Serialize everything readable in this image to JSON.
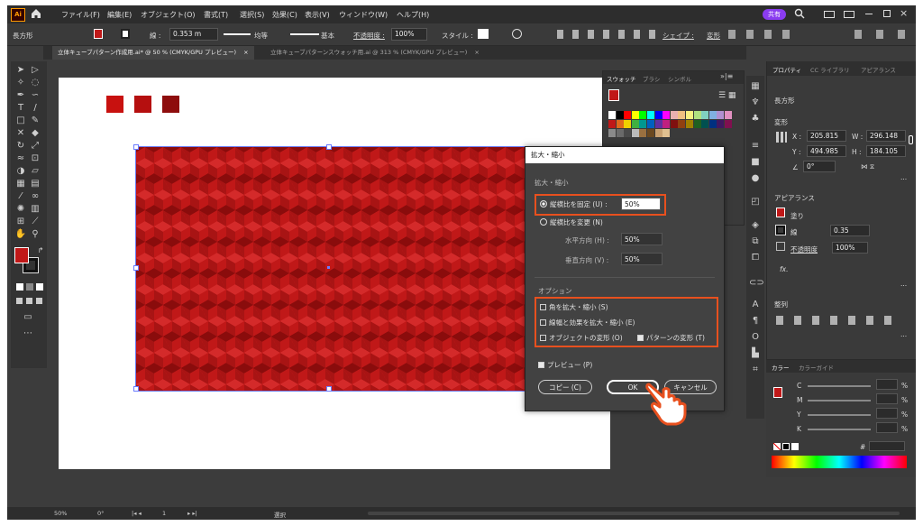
{
  "menubar": {
    "app_badge": "Ai",
    "items": [
      "ファイル(F)",
      "編集(E)",
      "オブジェクト(O)",
      "書式(T)",
      "選択(S)",
      "効果(C)",
      "表示(V)",
      "ウィンドウ(W)",
      "ヘルプ(H)"
    ],
    "share": "共有"
  },
  "control": {
    "object_type": "長方形",
    "stroke_label": "線 :",
    "stroke_value": "0.353 m",
    "stroke_profile": "均等",
    "brush": "基本",
    "opacity_label": "不透明度 :",
    "opacity_value": "100%",
    "style_label": "スタイル :",
    "shape_label": "シェイプ :",
    "transform_label": "変形"
  },
  "tabs": [
    {
      "label": "立体キューブパターン作成用.ai* @ 50 % (CMYK/GPU プレビュー)",
      "close": "×"
    },
    {
      "label": "立体キューブパターンスウォッチ用.ai @ 313 % (CMYK/GPU プレビュー)",
      "close": "×"
    }
  ],
  "swatches": {
    "tabs": [
      "スウォッチ",
      "ブラシ",
      "シンボル"
    ],
    "colors": [
      "#ffffff",
      "#000000",
      "#ff0000",
      "#ffff00",
      "#00ff00",
      "#00ffff",
      "#0000ff",
      "#ff00ff",
      "#e8b0b0",
      "#f0c080",
      "#f8f080",
      "#b0e080",
      "#80d0c0",
      "#80b0e0",
      "#b090d0",
      "#e090c0",
      "#c01818",
      "#e0681c",
      "#f0d000",
      "#40b040",
      "#009890",
      "#0060c0",
      "#6030a0",
      "#c02080",
      "#801010",
      "#904010",
      "#a08000",
      "#206020",
      "#005050",
      "#003080",
      "#401860",
      "#801050",
      "#8a8a8a",
      "#6a6a6a",
      "#4a4a4a",
      "#bbbbbb",
      "#9a7040",
      "#6a4820",
      "#c8a070",
      "#e0c090"
    ]
  },
  "dialog": {
    "title": "拡大・縮小",
    "section_scale": "拡大・縮小",
    "uniform_label": "縦横比を固定 (U) :",
    "uniform_value": "50%",
    "nonuniform_label": "縦横比を変更 (N)",
    "horizontal_label": "水平方向 (H) :",
    "horizontal_value": "50%",
    "vertical_label": "垂直方向 (V) :",
    "vertical_value": "50%",
    "section_options": "オプション",
    "opt_corners": "角を拡大・縮小 (S)",
    "opt_strokes": "線幅と効果を拡大・縮小 (E)",
    "opt_objects": "オブジェクトの変形 (O)",
    "opt_patterns": "パターンの変形 (T)",
    "preview": "プレビュー (P)",
    "copy_btn": "コピー (C)",
    "ok_btn": "OK",
    "cancel_btn": "キャンセル"
  },
  "properties": {
    "tabs": [
      "プロパティ",
      "CC ライブラリ",
      "アピアランス"
    ],
    "object_type": "長方形",
    "transform_title": "変形",
    "x_label": "X :",
    "x_value": "205.815",
    "w_label": "W :",
    "w_value": "296.148",
    "y_label": "Y :",
    "y_value": "494.985",
    "h_label": "H :",
    "h_value": "184.105",
    "angle_value": "0°",
    "appearance_title": "アピアランス",
    "fill_label": "塗り",
    "stroke_label": "線",
    "stroke_value": "0.35",
    "opacity_label": "不透明度",
    "opacity_value": "100%",
    "fx_label": "fx.",
    "align_title": "整列",
    "more": "..."
  },
  "color_panel": {
    "tabs": [
      "カラー",
      "カラーガイド"
    ],
    "channels": [
      {
        "label": "C",
        "unit": "%"
      },
      {
        "label": "M",
        "unit": "%"
      },
      {
        "label": "Y",
        "unit": "%"
      },
      {
        "label": "K",
        "unit": "%"
      }
    ],
    "hex_label": "#"
  },
  "status": {
    "zoom": "50%",
    "rotation": "0°",
    "artboard": "1",
    "tool": "選択"
  },
  "colors": {
    "accent": "#e8501e",
    "pattern_red": "#c01818",
    "square_1": "#c8110f",
    "square_2": "#b50f0f",
    "square_3": "#8e0d0d"
  }
}
